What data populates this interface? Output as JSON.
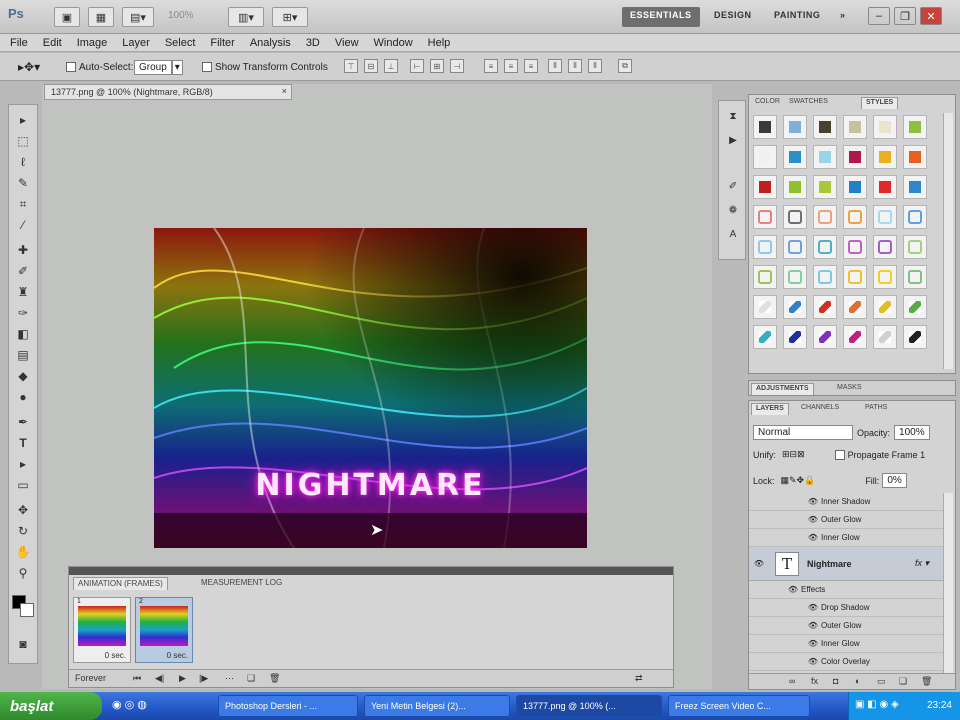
{
  "app": {
    "logo": "Ps",
    "zoom_value": "100%",
    "workspaces": [
      "ESSENTIALS",
      "DESIGN",
      "PAINTING",
      "»"
    ],
    "active_workspace": "ESSENTIALS"
  },
  "menu": [
    "File",
    "Edit",
    "Image",
    "Layer",
    "Select",
    "Filter",
    "Analysis",
    "3D",
    "View",
    "Window",
    "Help"
  ],
  "options": {
    "auto_select_label": "Auto-Select:",
    "auto_select_value": "Group",
    "show_transform_label": "Show Transform Controls"
  },
  "document": {
    "tab_title": "13777.png @ 100% (Nightmare, RGB/8)",
    "canvas_text": "NIGHTMARE"
  },
  "animation_panel": {
    "tabs": [
      "ANIMATION (FRAMES)",
      "MEASUREMENT LOG"
    ],
    "frames": [
      {
        "num": "1",
        "delay": "0 sec."
      },
      {
        "num": "2",
        "delay": "0 sec."
      }
    ],
    "loop": "Forever"
  },
  "styles_panel": {
    "tabs": [
      "COLOR",
      "SWATCHES",
      "STYLES"
    ],
    "active_tab": "STYLES"
  },
  "adjustments_bar": {
    "tabs": [
      "ADJUSTMENTS",
      "MASKS"
    ]
  },
  "layers_panel": {
    "tabs": [
      "LAYERS",
      "CHANNELS",
      "PATHS"
    ],
    "blend_mode": "Normal",
    "opacity_label": "Opacity:",
    "opacity_value": "100%",
    "unify_label": "Unify:",
    "propagate_label": "Propagate Frame 1",
    "lock_label": "Lock:",
    "fill_label": "Fill:",
    "fill_value": "0%",
    "top_effects": [
      "Inner Shadow",
      "Outer Glow",
      "Inner Glow"
    ],
    "text_layer_name": "Nightmare",
    "effects_label": "Effects",
    "effects": [
      "Drop Shadow",
      "Outer Glow",
      "Inner Glow",
      "Color Overlay"
    ]
  },
  "taskbar": {
    "start_label": "başlat",
    "items": [
      "Photoshop Dersleri - ...",
      "Yeni Metin Belgesi (2)...",
      "13777.png @ 100% (...",
      "Freez Screen Video C..."
    ],
    "active_item_index": 2,
    "clock": "23:24"
  }
}
